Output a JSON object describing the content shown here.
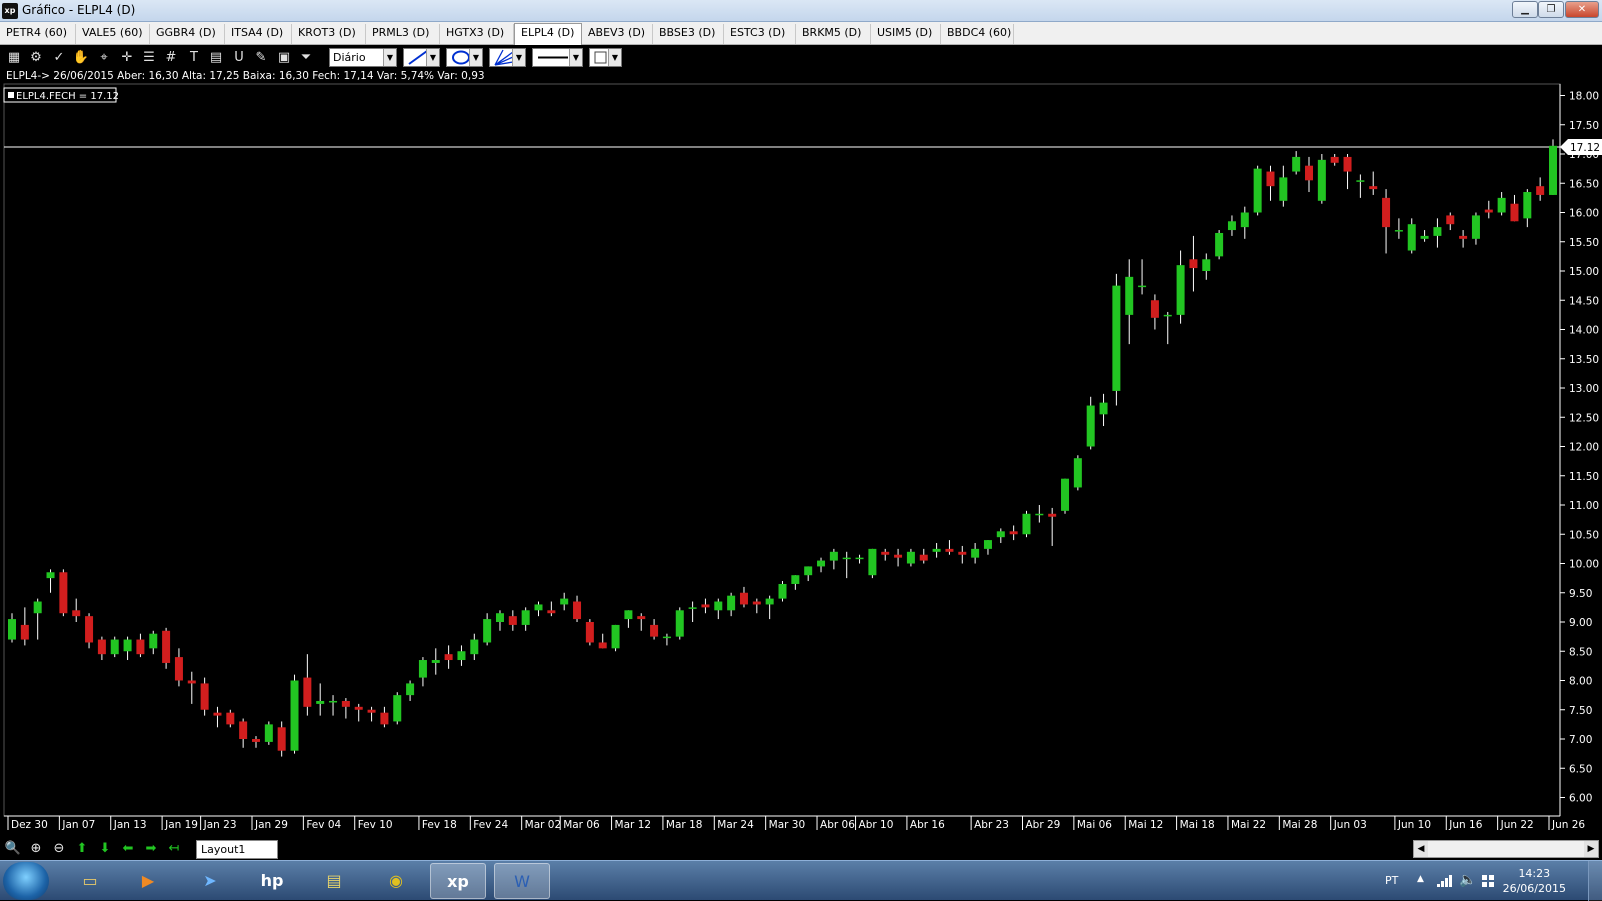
{
  "window": {
    "title": "Gráfico - ELPL4 (D)",
    "app_icon": "xp",
    "minimize": "▁",
    "maximize": "❐",
    "close": "✕"
  },
  "tabs": [
    {
      "label": "PETR4 (60)"
    },
    {
      "label": "VALE5 (60)"
    },
    {
      "label": "GGBR4 (D)"
    },
    {
      "label": "ITSA4 (D)"
    },
    {
      "label": "KROT3 (D)"
    },
    {
      "label": "PRML3 (D)"
    },
    {
      "label": "HGTX3 (D)"
    },
    {
      "label": "ELPL4 (D)",
      "active": true
    },
    {
      "label": "ABEV3 (D)"
    },
    {
      "label": "BBSE3 (D)"
    },
    {
      "label": "ESTC3 (D)"
    },
    {
      "label": "BRKM5 (D)"
    },
    {
      "label": "USIM5 (D)"
    },
    {
      "label": "BBDC4 (60)"
    }
  ],
  "toolbar": {
    "tools": [
      {
        "icon": "chart-type-icon",
        "glyph": "▦"
      },
      {
        "icon": "settings-gear-icon",
        "glyph": "⚙"
      },
      {
        "icon": "draw-trend-icon",
        "glyph": "✓"
      },
      {
        "icon": "hand-pan-icon",
        "glyph": "✋"
      },
      {
        "icon": "zoom-region-icon",
        "glyph": "⌖"
      },
      {
        "icon": "crosshair-icon",
        "glyph": "✛"
      },
      {
        "icon": "horizontal-lines-icon",
        "glyph": "☰"
      },
      {
        "icon": "grid-icon",
        "glyph": "#"
      },
      {
        "icon": "text-tool-icon",
        "glyph": "T"
      },
      {
        "icon": "calculator-icon",
        "glyph": "▤"
      },
      {
        "icon": "magnet-icon",
        "glyph": "U"
      },
      {
        "icon": "eraser-icon",
        "glyph": "✎"
      },
      {
        "icon": "clipboard-icon",
        "glyph": "▣"
      },
      {
        "icon": "filter-icon",
        "glyph": "⏷"
      }
    ],
    "period": "Diário",
    "line_style_icon": "line-tool-icon",
    "ellipse_icon": "ellipse-tool-icon",
    "fan_icon": "fan-tool-icon",
    "stroke_icon": "stroke-width-icon",
    "fill_icon": "fill-color-icon"
  },
  "chart_data": {
    "type": "candlestick",
    "ticker": "ELPL4",
    "info_line": "ELPL4-> 26/06/2015 Aber: 16,30 Alta: 17,25 Baixa: 16,30 Fech: 17,14 Var: 5,74% Var: 0,93",
    "legend_label": "ELPL4.FECH = 17.12",
    "last_price_label": "17.12",
    "last_price": 17.12,
    "y_axis": {
      "min": 6.0,
      "max": 18.0,
      "step": 0.5,
      "position": "right",
      "tick_labels": [
        "18.00",
        "17.50",
        "17.00",
        "16.50",
        "16.00",
        "15.50",
        "15.00",
        "14.50",
        "14.00",
        "13.50",
        "13.00",
        "12.50",
        "12.00",
        "11.50",
        "11.00",
        "10.50",
        "10.00",
        "9.50",
        "9.00",
        "8.50",
        "8.00",
        "7.50",
        "7.00",
        "6.50",
        "6.00"
      ]
    },
    "x_axis": {
      "date_labels": [
        "Dez 30",
        "Jan 07",
        "Jan 13",
        "Jan 19",
        "Jan 23",
        "Jan 29",
        "Fev 04",
        "Fev 10",
        "Fev 18",
        "Fev 24",
        "Mar 02",
        "Mar 06",
        "Mar 12",
        "Mar 18",
        "Mar 24",
        "Mar 30",
        "Abr 06",
        "Abr 10",
        "Abr 16",
        "Abr 23",
        "Abr 29",
        "Mai 06",
        "Mai 12",
        "Mai 18",
        "Mai 22",
        "Mai 28",
        "Jun 03",
        "Jun 10",
        "Jun 16",
        "Jun 22",
        "Jun 26"
      ]
    },
    "colors": {
      "up": "#22c522",
      "down": "#d21e1e",
      "background": "#000000",
      "axis": "#ffffff",
      "price_line": "#ffffff"
    },
    "candles": [
      {
        "o": 8.7,
        "h": 9.15,
        "l": 8.65,
        "c": 9.05
      },
      {
        "o": 8.95,
        "h": 9.25,
        "l": 8.6,
        "c": 8.7
      },
      {
        "o": 9.15,
        "h": 9.4,
        "l": 8.7,
        "c": 9.35
      },
      {
        "o": 9.75,
        "h": 9.9,
        "l": 9.5,
        "c": 9.85
      },
      {
        "o": 9.85,
        "h": 9.9,
        "l": 9.1,
        "c": 9.15
      },
      {
        "o": 9.2,
        "h": 9.4,
        "l": 9.0,
        "c": 9.1
      },
      {
        "o": 9.1,
        "h": 9.15,
        "l": 8.55,
        "c": 8.65
      },
      {
        "o": 8.7,
        "h": 8.75,
        "l": 8.35,
        "c": 8.45
      },
      {
        "o": 8.45,
        "h": 8.75,
        "l": 8.4,
        "c": 8.7
      },
      {
        "o": 8.5,
        "h": 8.75,
        "l": 8.35,
        "c": 8.7
      },
      {
        "o": 8.7,
        "h": 8.8,
        "l": 8.4,
        "c": 8.45
      },
      {
        "o": 8.55,
        "h": 8.85,
        "l": 8.45,
        "c": 8.8
      },
      {
        "o": 8.85,
        "h": 8.9,
        "l": 8.2,
        "c": 8.3
      },
      {
        "o": 8.4,
        "h": 8.55,
        "l": 7.9,
        "c": 8.0
      },
      {
        "o": 8.0,
        "h": 8.15,
        "l": 7.6,
        "c": 7.95
      },
      {
        "o": 7.95,
        "h": 8.05,
        "l": 7.4,
        "c": 7.5
      },
      {
        "o": 7.45,
        "h": 7.55,
        "l": 7.2,
        "c": 7.4
      },
      {
        "o": 7.45,
        "h": 7.5,
        "l": 7.2,
        "c": 7.25
      },
      {
        "o": 7.3,
        "h": 7.35,
        "l": 6.85,
        "c": 7.0
      },
      {
        "o": 7.0,
        "h": 7.05,
        "l": 6.85,
        "c": 6.95
      },
      {
        "o": 6.95,
        "h": 7.3,
        "l": 6.9,
        "c": 7.25
      },
      {
        "o": 7.2,
        "h": 7.3,
        "l": 6.7,
        "c": 6.8
      },
      {
        "o": 6.8,
        "h": 8.1,
        "l": 6.75,
        "c": 8.0
      },
      {
        "o": 8.05,
        "h": 8.45,
        "l": 7.4,
        "c": 7.55
      },
      {
        "o": 7.6,
        "h": 7.95,
        "l": 7.4,
        "c": 7.65
      },
      {
        "o": 7.65,
        "h": 7.75,
        "l": 7.4,
        "c": 7.65
      },
      {
        "o": 7.65,
        "h": 7.7,
        "l": 7.35,
        "c": 7.55
      },
      {
        "o": 7.55,
        "h": 7.6,
        "l": 7.3,
        "c": 7.5
      },
      {
        "o": 7.5,
        "h": 7.55,
        "l": 7.3,
        "c": 7.45
      },
      {
        "o": 7.45,
        "h": 7.55,
        "l": 7.2,
        "c": 7.25
      },
      {
        "o": 7.3,
        "h": 7.8,
        "l": 7.25,
        "c": 7.75
      },
      {
        "o": 7.75,
        "h": 8.0,
        "l": 7.65,
        "c": 7.95
      },
      {
        "o": 8.05,
        "h": 8.4,
        "l": 7.9,
        "c": 8.35
      },
      {
        "o": 8.3,
        "h": 8.55,
        "l": 8.1,
        "c": 8.35
      },
      {
        "o": 8.45,
        "h": 8.6,
        "l": 8.2,
        "c": 8.35
      },
      {
        "o": 8.35,
        "h": 8.6,
        "l": 8.25,
        "c": 8.5
      },
      {
        "o": 8.45,
        "h": 8.8,
        "l": 8.35,
        "c": 8.7
      },
      {
        "o": 8.65,
        "h": 9.15,
        "l": 8.6,
        "c": 9.05
      },
      {
        "o": 9.0,
        "h": 9.2,
        "l": 8.85,
        "c": 9.15
      },
      {
        "o": 9.1,
        "h": 9.2,
        "l": 8.85,
        "c": 8.95
      },
      {
        "o": 8.95,
        "h": 9.25,
        "l": 8.85,
        "c": 9.2
      },
      {
        "o": 9.2,
        "h": 9.35,
        "l": 9.1,
        "c": 9.3
      },
      {
        "o": 9.2,
        "h": 9.35,
        "l": 9.1,
        "c": 9.15
      },
      {
        "o": 9.3,
        "h": 9.5,
        "l": 9.2,
        "c": 9.4
      },
      {
        "o": 9.35,
        "h": 9.45,
        "l": 9.0,
        "c": 9.05
      },
      {
        "o": 9.0,
        "h": 9.05,
        "l": 8.6,
        "c": 8.65
      },
      {
        "o": 8.65,
        "h": 8.8,
        "l": 8.55,
        "c": 8.55
      },
      {
        "o": 8.55,
        "h": 8.95,
        "l": 8.5,
        "c": 8.95
      },
      {
        "o": 9.05,
        "h": 9.2,
        "l": 8.9,
        "c": 9.2
      },
      {
        "o": 9.1,
        "h": 9.15,
        "l": 8.85,
        "c": 9.05
      },
      {
        "o": 8.95,
        "h": 9.05,
        "l": 8.7,
        "c": 8.75
      },
      {
        "o": 8.75,
        "h": 8.8,
        "l": 8.6,
        "c": 8.75
      },
      {
        "o": 8.75,
        "h": 9.25,
        "l": 8.7,
        "c": 9.2
      },
      {
        "o": 9.25,
        "h": 9.35,
        "l": 9.0,
        "c": 9.25
      },
      {
        "o": 9.3,
        "h": 9.4,
        "l": 9.15,
        "c": 9.25
      },
      {
        "o": 9.2,
        "h": 9.4,
        "l": 9.05,
        "c": 9.35
      },
      {
        "o": 9.2,
        "h": 9.5,
        "l": 9.1,
        "c": 9.45
      },
      {
        "o": 9.5,
        "h": 9.6,
        "l": 9.25,
        "c": 9.3
      },
      {
        "o": 9.35,
        "h": 9.4,
        "l": 9.15,
        "c": 9.3
      },
      {
        "o": 9.3,
        "h": 9.45,
        "l": 9.05,
        "c": 9.4
      },
      {
        "o": 9.4,
        "h": 9.7,
        "l": 9.35,
        "c": 9.65
      },
      {
        "o": 9.65,
        "h": 9.8,
        "l": 9.55,
        "c": 9.8
      },
      {
        "o": 9.8,
        "h": 9.95,
        "l": 9.7,
        "c": 9.95
      },
      {
        "o": 9.95,
        "h": 10.1,
        "l": 9.85,
        "c": 10.05
      },
      {
        "o": 10.05,
        "h": 10.25,
        "l": 9.9,
        "c": 10.2
      },
      {
        "o": 10.1,
        "h": 10.2,
        "l": 9.75,
        "c": 10.1
      },
      {
        "o": 10.1,
        "h": 10.15,
        "l": 10.0,
        "c": 10.1
      },
      {
        "o": 9.8,
        "h": 10.25,
        "l": 9.75,
        "c": 10.25
      },
      {
        "o": 10.2,
        "h": 10.25,
        "l": 10.05,
        "c": 10.15
      },
      {
        "o": 10.15,
        "h": 10.25,
        "l": 9.95,
        "c": 10.1
      },
      {
        "o": 10.0,
        "h": 10.25,
        "l": 9.95,
        "c": 10.2
      },
      {
        "o": 10.15,
        "h": 10.25,
        "l": 10.0,
        "c": 10.05
      },
      {
        "o": 10.2,
        "h": 10.35,
        "l": 10.1,
        "c": 10.25
      },
      {
        "o": 10.25,
        "h": 10.4,
        "l": 10.15,
        "c": 10.2
      },
      {
        "o": 10.2,
        "h": 10.3,
        "l": 10.0,
        "c": 10.15
      },
      {
        "o": 10.1,
        "h": 10.35,
        "l": 10.0,
        "c": 10.25
      },
      {
        "o": 10.25,
        "h": 10.4,
        "l": 10.15,
        "c": 10.4
      },
      {
        "o": 10.45,
        "h": 10.6,
        "l": 10.35,
        "c": 10.55
      },
      {
        "o": 10.55,
        "h": 10.65,
        "l": 10.4,
        "c": 10.5
      },
      {
        "o": 10.5,
        "h": 10.9,
        "l": 10.45,
        "c": 10.85
      },
      {
        "o": 10.85,
        "h": 11.0,
        "l": 10.7,
        "c": 10.85
      },
      {
        "o": 10.85,
        "h": 10.95,
        "l": 10.3,
        "c": 10.8
      },
      {
        "o": 10.9,
        "h": 11.45,
        "l": 10.85,
        "c": 11.45
      },
      {
        "o": 11.3,
        "h": 11.85,
        "l": 11.25,
        "c": 11.8
      },
      {
        "o": 12.0,
        "h": 12.85,
        "l": 11.95,
        "c": 12.7
      },
      {
        "o": 12.55,
        "h": 12.9,
        "l": 12.35,
        "c": 12.75
      },
      {
        "o": 12.95,
        "h": 14.95,
        "l": 12.7,
        "c": 14.75
      },
      {
        "o": 14.25,
        "h": 15.2,
        "l": 13.75,
        "c": 14.9
      },
      {
        "o": 14.75,
        "h": 15.2,
        "l": 14.6,
        "c": 14.75
      },
      {
        "o": 14.5,
        "h": 14.6,
        "l": 14.0,
        "c": 14.2
      },
      {
        "o": 14.25,
        "h": 14.3,
        "l": 13.75,
        "c": 14.25
      },
      {
        "o": 14.25,
        "h": 15.35,
        "l": 14.1,
        "c": 15.1
      },
      {
        "o": 15.2,
        "h": 15.6,
        "l": 14.65,
        "c": 15.05
      },
      {
        "o": 15.0,
        "h": 15.3,
        "l": 14.85,
        "c": 15.2
      },
      {
        "o": 15.25,
        "h": 15.7,
        "l": 15.2,
        "c": 15.65
      },
      {
        "o": 15.7,
        "h": 15.95,
        "l": 15.6,
        "c": 15.85
      },
      {
        "o": 15.75,
        "h": 16.1,
        "l": 15.55,
        "c": 16.0
      },
      {
        "o": 16.0,
        "h": 16.8,
        "l": 15.95,
        "c": 16.75
      },
      {
        "o": 16.7,
        "h": 16.8,
        "l": 16.2,
        "c": 16.45
      },
      {
        "o": 16.2,
        "h": 16.8,
        "l": 16.1,
        "c": 16.6
      },
      {
        "o": 16.7,
        "h": 17.05,
        "l": 16.65,
        "c": 16.95
      },
      {
        "o": 16.8,
        "h": 16.95,
        "l": 16.35,
        "c": 16.55
      },
      {
        "o": 16.2,
        "h": 17.0,
        "l": 16.15,
        "c": 16.9
      },
      {
        "o": 16.95,
        "h": 17.0,
        "l": 16.8,
        "c": 16.85
      },
      {
        "o": 16.95,
        "h": 17.0,
        "l": 16.4,
        "c": 16.7
      },
      {
        "o": 16.55,
        "h": 16.65,
        "l": 16.25,
        "c": 16.55
      },
      {
        "o": 16.45,
        "h": 16.7,
        "l": 16.3,
        "c": 16.4
      },
      {
        "o": 16.25,
        "h": 16.4,
        "l": 15.3,
        "c": 15.75
      },
      {
        "o": 15.7,
        "h": 15.9,
        "l": 15.55,
        "c": 15.7
      },
      {
        "o": 15.35,
        "h": 15.9,
        "l": 15.3,
        "c": 15.8
      },
      {
        "o": 15.55,
        "h": 15.7,
        "l": 15.5,
        "c": 15.6
      },
      {
        "o": 15.6,
        "h": 15.9,
        "l": 15.4,
        "c": 15.75
      },
      {
        "o": 15.95,
        "h": 16.0,
        "l": 15.7,
        "c": 15.8
      },
      {
        "o": 15.6,
        "h": 15.7,
        "l": 15.4,
        "c": 15.55
      },
      {
        "o": 15.55,
        "h": 16.0,
        "l": 15.45,
        "c": 15.95
      },
      {
        "o": 16.05,
        "h": 16.2,
        "l": 15.9,
        "c": 16.0
      },
      {
        "o": 16.0,
        "h": 16.35,
        "l": 15.95,
        "c": 16.25
      },
      {
        "o": 16.15,
        "h": 16.3,
        "l": 15.85,
        "c": 15.85
      },
      {
        "o": 15.9,
        "h": 16.4,
        "l": 15.75,
        "c": 16.35
      },
      {
        "o": 16.45,
        "h": 16.6,
        "l": 16.2,
        "c": 16.3
      },
      {
        "o": 16.3,
        "h": 17.25,
        "l": 16.3,
        "c": 17.14
      }
    ]
  },
  "bottombar": {
    "tools": [
      {
        "icon": "zoom-fit-icon",
        "glyph": "🔍",
        "color": "#e8e8e8"
      },
      {
        "icon": "zoom-in-icon",
        "glyph": "⊕",
        "color": "#e8e8e8"
      },
      {
        "icon": "zoom-out-icon",
        "glyph": "⊖",
        "color": "#e8e8e8"
      },
      {
        "icon": "arrow-up-icon",
        "glyph": "⬆",
        "color": "#22c522"
      },
      {
        "icon": "arrow-down-icon",
        "glyph": "⬇",
        "color": "#22c522"
      },
      {
        "icon": "arrow-left-icon",
        "glyph": "⬅",
        "color": "#22c522"
      },
      {
        "icon": "arrow-right-icon",
        "glyph": "➡",
        "color": "#22c522"
      },
      {
        "icon": "arrow-return-icon",
        "glyph": "↤",
        "color": "#22c522"
      }
    ],
    "layout_tab": "Layout1"
  },
  "taskbar": {
    "apps": [
      {
        "name": "explorer-icon",
        "glyph": "▭",
        "color": "#e7c96a"
      },
      {
        "name": "media-player-icon",
        "glyph": "▶",
        "color": "#f08a24"
      },
      {
        "name": "network-app-icon",
        "glyph": "➤",
        "color": "#6fb7ff"
      },
      {
        "name": "hp-icon",
        "glyph": "hp",
        "color": "#ffffff"
      },
      {
        "name": "scanner-app-icon",
        "glyph": "▤",
        "color": "#e6d36b"
      },
      {
        "name": "chrome-icon",
        "glyph": "◉",
        "color": "#e0c020"
      },
      {
        "name": "xp-app-icon",
        "glyph": "xp",
        "color": "#ffffff",
        "active": true
      },
      {
        "name": "word-icon",
        "glyph": "W",
        "color": "#2b5fb4",
        "active": true
      }
    ],
    "language": "PT",
    "time": "14:23",
    "date": "26/06/2015"
  }
}
